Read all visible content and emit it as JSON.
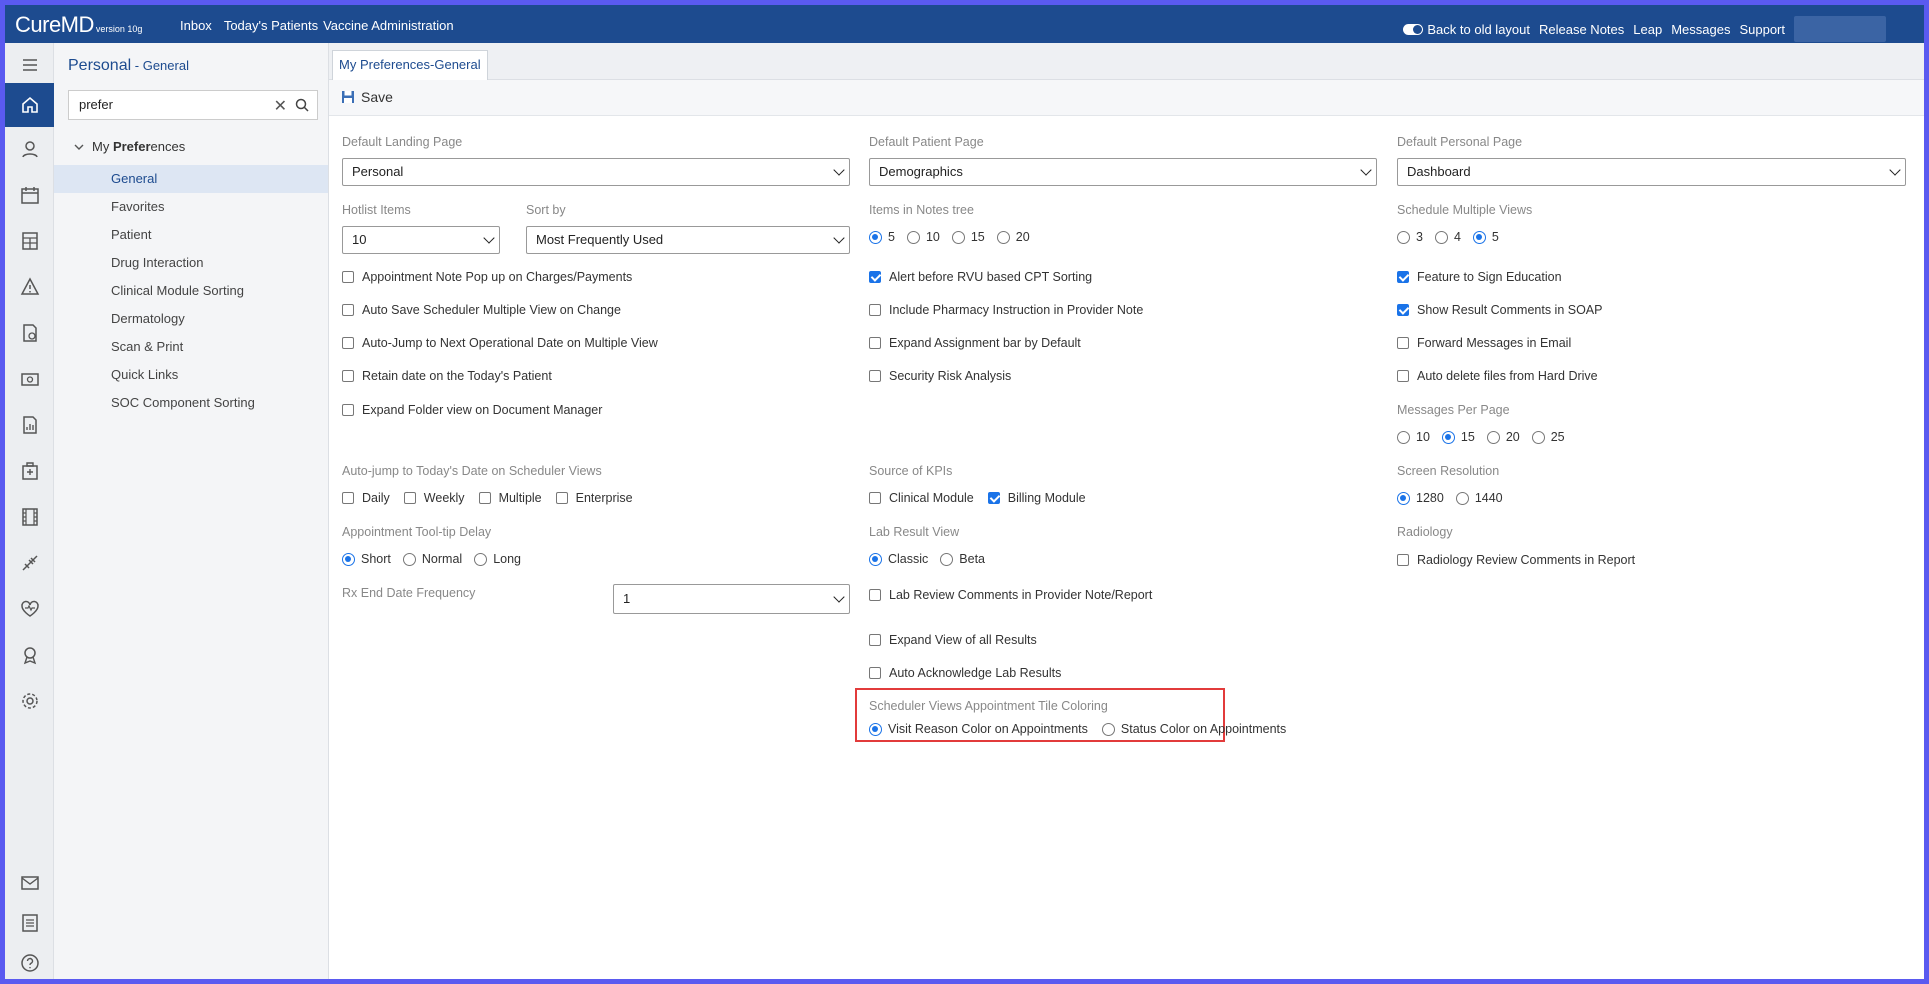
{
  "app": {
    "logo": "CureMD",
    "version": "version 10g"
  },
  "topnav": [
    "Inbox",
    "Today's Patients",
    "Vaccine Administration"
  ],
  "topright": {
    "back_old": "Back to old layout",
    "links": [
      "Release Notes",
      "Leap",
      "Messages",
      "Support"
    ]
  },
  "sidebar": {
    "title": "Personal",
    "subtitle": " - General",
    "search_value": "prefer",
    "root_prefix": "My ",
    "root_bold": "Prefer",
    "root_suffix": "ences",
    "items": [
      {
        "label": "General",
        "active": true
      },
      {
        "label": "Favorites"
      },
      {
        "label": "Patient"
      },
      {
        "label": "Drug Interaction"
      },
      {
        "label": "Clinical Module Sorting"
      },
      {
        "label": "Dermatology"
      },
      {
        "label": "Scan & Print"
      },
      {
        "label": "Quick Links"
      },
      {
        "label": "SOC Component Sorting"
      }
    ]
  },
  "tab": "My Preferences-General",
  "toolbar": {
    "save": "Save"
  },
  "form": {
    "landing": {
      "label": "Default Landing Page",
      "value": "Personal"
    },
    "patient_page": {
      "label": "Default Patient Page",
      "value": "Demographics"
    },
    "personal_page": {
      "label": "Default Personal Page",
      "value": "Dashboard"
    },
    "hotlist": {
      "label": "Hotlist Items",
      "value": "10"
    },
    "sortby": {
      "label": "Sort by",
      "value": "Most Frequently Used"
    },
    "notes_tree": {
      "label": "Items in Notes tree",
      "options": [
        "5",
        "10",
        "15",
        "20"
      ],
      "selected": "5"
    },
    "sched_views": {
      "label": "Schedule Multiple Views",
      "options": [
        "3",
        "4",
        "5"
      ],
      "selected": "5"
    },
    "col1_checks": [
      {
        "label": "Appointment Note Pop up on Charges/Payments",
        "checked": false
      },
      {
        "label": "Auto Save Scheduler Multiple View on Change",
        "checked": false
      },
      {
        "label": "Auto-Jump to Next Operational Date on Multiple View",
        "checked": false
      },
      {
        "label": "Retain date on the Today's Patient",
        "checked": false
      },
      {
        "label": "Expand Folder view on Document Manager",
        "checked": false
      }
    ],
    "col2_checks": [
      {
        "label": "Alert before RVU based CPT Sorting",
        "checked": true
      },
      {
        "label": "Include Pharmacy Instruction in Provider Note",
        "checked": false
      },
      {
        "label": "Expand Assignment bar by Default",
        "checked": false
      },
      {
        "label": "Security Risk Analysis",
        "checked": false
      }
    ],
    "col3_checks": [
      {
        "label": "Feature to Sign Education",
        "checked": true
      },
      {
        "label": "Show Result Comments in SOAP",
        "checked": true
      },
      {
        "label": "Forward Messages in Email",
        "checked": false
      },
      {
        "label": "Auto delete files from Hard Drive",
        "checked": false
      }
    ],
    "messages_per_page": {
      "label": "Messages Per Page",
      "options": [
        "10",
        "15",
        "20",
        "25"
      ],
      "selected": "15"
    },
    "autojump": {
      "label": "Auto-jump to Today's Date on Scheduler Views",
      "options": [
        "Daily",
        "Weekly",
        "Multiple",
        "Enterprise"
      ]
    },
    "kpi": {
      "label": "Source of KPIs",
      "options": [
        {
          "label": "Clinical Module",
          "checked": false
        },
        {
          "label": "Billing Module",
          "checked": true
        }
      ]
    },
    "resolution": {
      "label": "Screen Resolution",
      "options": [
        "1280",
        "1440"
      ],
      "selected": "1280"
    },
    "tooltip_delay": {
      "label": "Appointment Tool-tip Delay",
      "options": [
        "Short",
        "Normal",
        "Long"
      ],
      "selected": "Short"
    },
    "lab_result": {
      "label": "Lab Result View",
      "options": [
        "Classic",
        "Beta"
      ],
      "selected": "Classic"
    },
    "radiology": {
      "label": "Radiology",
      "check": "Radiology Review Comments in Report"
    },
    "rx_end": {
      "label": "Rx End Date Frequency",
      "value": "1"
    },
    "lab_checks": [
      {
        "label": "Lab Review Comments in Provider Note/Report"
      },
      {
        "label": "Expand View of all Results"
      },
      {
        "label": "Auto Acknowledge Lab Results"
      }
    ],
    "tile_coloring": {
      "label": "Scheduler Views Appointment Tile Coloring",
      "options": [
        "Visit Reason Color on Appointments",
        "Status Color on Appointments"
      ],
      "selected": "Visit Reason Color on Appointments"
    }
  },
  "colors": {
    "brand": "#1d4b8f",
    "accent": "#1a73e8",
    "highlight": "#e23b3b"
  }
}
